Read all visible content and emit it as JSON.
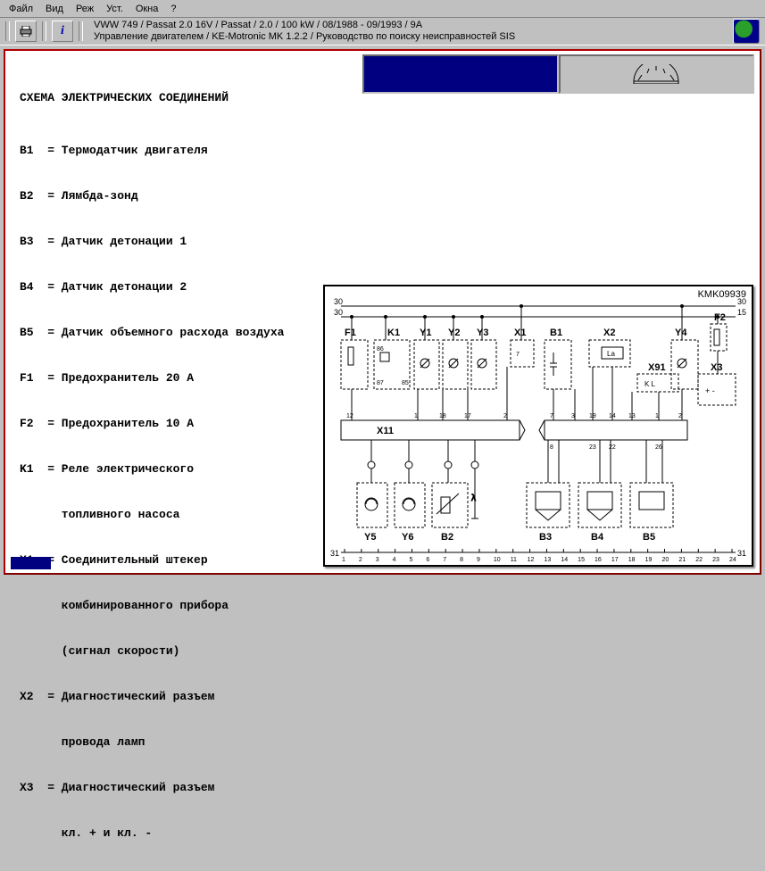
{
  "menu": {
    "items": [
      "Файл",
      "Вид",
      "Реж",
      "Уст.",
      "Окна",
      "?"
    ]
  },
  "toolbar": {
    "print_title": "Печать",
    "info_title": "Информация"
  },
  "breadcrumb": {
    "line1": "VWW 749 / Passat 2.0 16V / Passat / 2.0 / 100 kW / 08/1988 - 09/1993 / 9A",
    "line2": "Управление двигателем / KE-Motronic MK 1.2.2 / Руководство по поиску неисправностей SIS"
  },
  "legend": {
    "title": "СХЕМА ЭЛЕКТРИЧЕСКИХ СОЕДИНЕНИЙ",
    "rows": [
      "B1  = Термодатчик двигателя",
      "B2  = Лямбда-зонд",
      "B3  = Датчик детонации 1",
      "B4  = Датчик детонации 2",
      "B5  = Датчик объемного расхода воздуха",
      "F1  = Предохранитель 20 А",
      "F2  = Предохранитель 10 А",
      "K1  = Реле электрического",
      "      топливного насоса",
      "X1  = Соединительный штекер",
      "      комбинированного прибора",
      "      (сигнал скорости)",
      "X2  = Диагностический разъем",
      "      провода ламп",
      "X3  = Диагностический разъем",
      "      кл. + и кл. -"
    ]
  },
  "diagram": {
    "id": "KMK09939",
    "rail_left": "30",
    "rail_right": "30",
    "out_left": "30",
    "out_right": "15",
    "bottom_left": "31",
    "bottom_right": "31",
    "components": [
      "F1",
      "K1",
      "Y1",
      "Y2",
      "Y3",
      "X1",
      "B1",
      "X2",
      "Y4",
      "F2",
      "X11",
      "X91",
      "X3",
      "Y5",
      "Y6",
      "B2",
      "B3",
      "B4",
      "B5"
    ],
    "x11_pins": [
      "12",
      "1",
      "18",
      "17",
      "2",
      "7",
      "3",
      "19",
      "14",
      "13",
      "1",
      "2",
      "8",
      "23",
      "22",
      "26"
    ],
    "k1_pins": [
      "86",
      "87",
      "85"
    ],
    "x1_pin": "7",
    "x2_note": "La",
    "x91_note": "K  L",
    "x3_note": "+   -",
    "terminals": [
      "1",
      "2",
      "3",
      "4",
      "5",
      "6",
      "7",
      "8",
      "9",
      "10",
      "11",
      "12",
      "13",
      "14",
      "15",
      "16",
      "17",
      "18",
      "19",
      "20",
      "21",
      "22",
      "23",
      "24"
    ]
  }
}
